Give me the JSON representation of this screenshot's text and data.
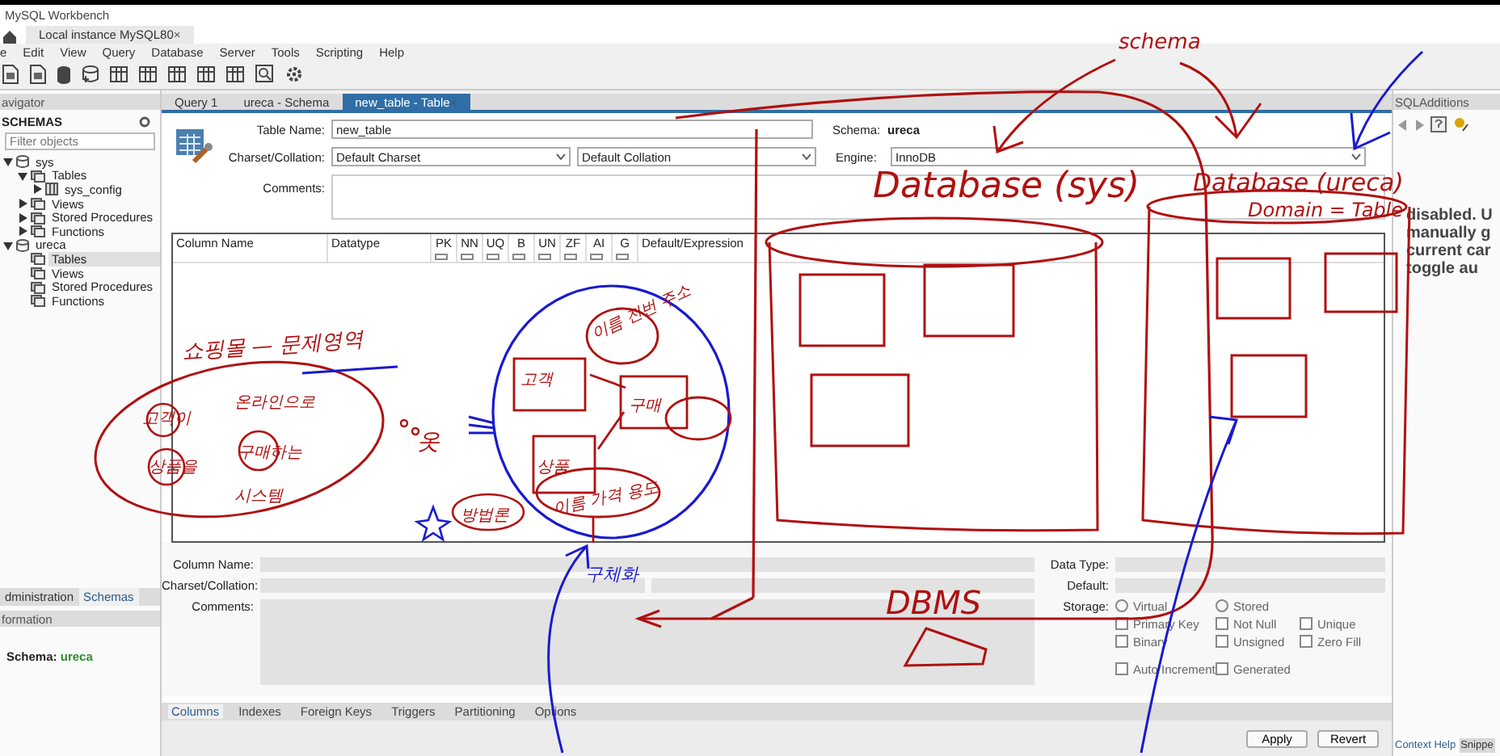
{
  "window": {
    "title": "MySQL Workbench"
  },
  "connection_tabs": [
    {
      "label": "Local instance MySQL80",
      "selected": true,
      "close": "×"
    }
  ],
  "menu": [
    "e",
    "Edit",
    "View",
    "Query",
    "Database",
    "Server",
    "Tools",
    "Scripting",
    "Help"
  ],
  "navigator": {
    "header": "avigator",
    "section": "SCHEMAS",
    "filter_placeholder": "Filter objects",
    "tree": [
      {
        "label": "sys",
        "kind": "schema",
        "selected": false,
        "expanded": true,
        "children": [
          {
            "label": "Tables",
            "kind": "folder",
            "selected": false,
            "expanded": true,
            "children": [
              {
                "label": "sys_config",
                "kind": "table",
                "selected": false,
                "expanded": false
              }
            ]
          },
          {
            "label": "Views",
            "kind": "folder",
            "selected": false,
            "expanded": false
          },
          {
            "label": "Stored Procedures",
            "kind": "folder",
            "selected": false,
            "expanded": false
          },
          {
            "label": "Functions",
            "kind": "folder",
            "selected": false,
            "expanded": false
          }
        ]
      },
      {
        "label": "ureca",
        "kind": "schema",
        "selected": false,
        "expanded": true,
        "children": [
          {
            "label": "Tables",
            "kind": "folder",
            "selected": true
          },
          {
            "label": "Views",
            "kind": "folder",
            "selected": false
          },
          {
            "label": "Stored Procedures",
            "kind": "folder",
            "selected": false
          },
          {
            "label": "Functions",
            "kind": "folder",
            "selected": false
          }
        ]
      }
    ]
  },
  "side_tabs": [
    {
      "label": "dministration",
      "selected": false
    },
    {
      "label": "Schemas",
      "selected": true
    }
  ],
  "information": {
    "header": "formation",
    "label": "Schema:",
    "value": "ureca"
  },
  "editor_tabs": [
    {
      "label": "Query 1",
      "selected": false
    },
    {
      "label": "ureca - Schema",
      "selected": false
    },
    {
      "label": "new_table - Table",
      "selected": true,
      "close": "×"
    }
  ],
  "table_form": {
    "table_name_label": "Table Name:",
    "table_name": "new_table",
    "schema_label": "Schema:",
    "schema": "ureca",
    "charset_label": "Charset/Collation:",
    "charset": "Default Charset",
    "collation": "Default Collation",
    "engine_label": "Engine:",
    "engine": "InnoDB",
    "comments_label": "Comments:"
  },
  "columns_grid": {
    "columns": [
      {
        "label": "Column Name",
        "kind": "text"
      },
      {
        "label": "Datatype",
        "kind": "text"
      },
      {
        "label": "PK",
        "kind": "flag",
        "checked": false
      },
      {
        "label": "NN",
        "kind": "flag",
        "checked": false
      },
      {
        "label": "UQ",
        "kind": "flag",
        "checked": false
      },
      {
        "label": "B",
        "kind": "flag",
        "checked": false
      },
      {
        "label": "UN",
        "kind": "flag",
        "checked": false
      },
      {
        "label": "ZF",
        "kind": "flag",
        "checked": false
      },
      {
        "label": "AI",
        "kind": "flag",
        "checked": false
      },
      {
        "label": "G",
        "kind": "flag",
        "checked": false
      },
      {
        "label": "Default/Expression",
        "kind": "text"
      }
    ]
  },
  "column_details": {
    "column_name_label": "Column Name:",
    "charset_label": "Charset/Collation:",
    "comments_label": "Comments:",
    "data_type_label": "Data Type:",
    "default_label": "Default:",
    "storage_label": "Storage:",
    "options": [
      {
        "label": "Virtual",
        "kind": "radio",
        "checked": false
      },
      {
        "label": "Stored",
        "kind": "radio",
        "checked": false
      },
      {
        "label": "Primary Key",
        "kind": "checkbox",
        "checked": false
      },
      {
        "label": "Not Null",
        "kind": "checkbox",
        "checked": false
      },
      {
        "label": "Unique",
        "kind": "checkbox",
        "checked": false
      },
      {
        "label": "Binary",
        "kind": "checkbox",
        "checked": false
      },
      {
        "label": "Unsigned",
        "kind": "checkbox",
        "checked": false
      },
      {
        "label": "Zero Fill",
        "kind": "checkbox",
        "checked": false
      },
      {
        "label": "Auto Increment",
        "kind": "checkbox",
        "checked": false
      },
      {
        "label": "Generated",
        "kind": "checkbox",
        "checked": false
      }
    ]
  },
  "detail_tabs": [
    {
      "label": "Columns",
      "selected": true
    },
    {
      "label": "Indexes",
      "selected": false
    },
    {
      "label": "Foreign Keys",
      "selected": false
    },
    {
      "label": "Triggers",
      "selected": false
    },
    {
      "label": "Partitioning",
      "selected": false
    },
    {
      "label": "Options",
      "selected": false
    }
  ],
  "buttons": [
    "Apply",
    "Revert"
  ],
  "sql_additions": {
    "title": "SQLAdditions",
    "help_lines": [
      "disabled. U",
      "manually g",
      "current car",
      "toggle au"
    ],
    "tabs": [
      {
        "label": "Context Help",
        "selected": true
      },
      {
        "label": "Snippe",
        "selected": false
      }
    ]
  },
  "annotations": [
    {
      "text": "schema",
      "color": "#b01010"
    },
    {
      "text": "Database (sys)",
      "color": "#b01010"
    },
    {
      "text": "Database (ureca)",
      "color": "#b01010"
    },
    {
      "text": "Domain = Table",
      "color": "#b01010"
    },
    {
      "text": "DBMS",
      "color": "#b01010"
    },
    {
      "text": "쇼핑몰 — 문제영역",
      "color": "#b01010"
    },
    {
      "text": "고객이",
      "color": "#b01010"
    },
    {
      "text": "온라인으로",
      "color": "#b01010"
    },
    {
      "text": "상품을",
      "color": "#b01010"
    },
    {
      "text": "구매하는",
      "color": "#b01010"
    },
    {
      "text": "시스템",
      "color": "#b01010"
    },
    {
      "text": "옷",
      "color": "#b01010"
    },
    {
      "text": "고객",
      "color": "#b01010"
    },
    {
      "text": "이름 전번 주소",
      "color": "#b01010"
    },
    {
      "text": "구매",
      "color": "#b01010"
    },
    {
      "text": "상품",
      "color": "#b01010"
    },
    {
      "text": "이름 가격 용도",
      "color": "#b01010"
    },
    {
      "text": "방법론",
      "color": "#b01010"
    },
    {
      "text": "구체화",
      "color": "#1a1ad0"
    }
  ]
}
